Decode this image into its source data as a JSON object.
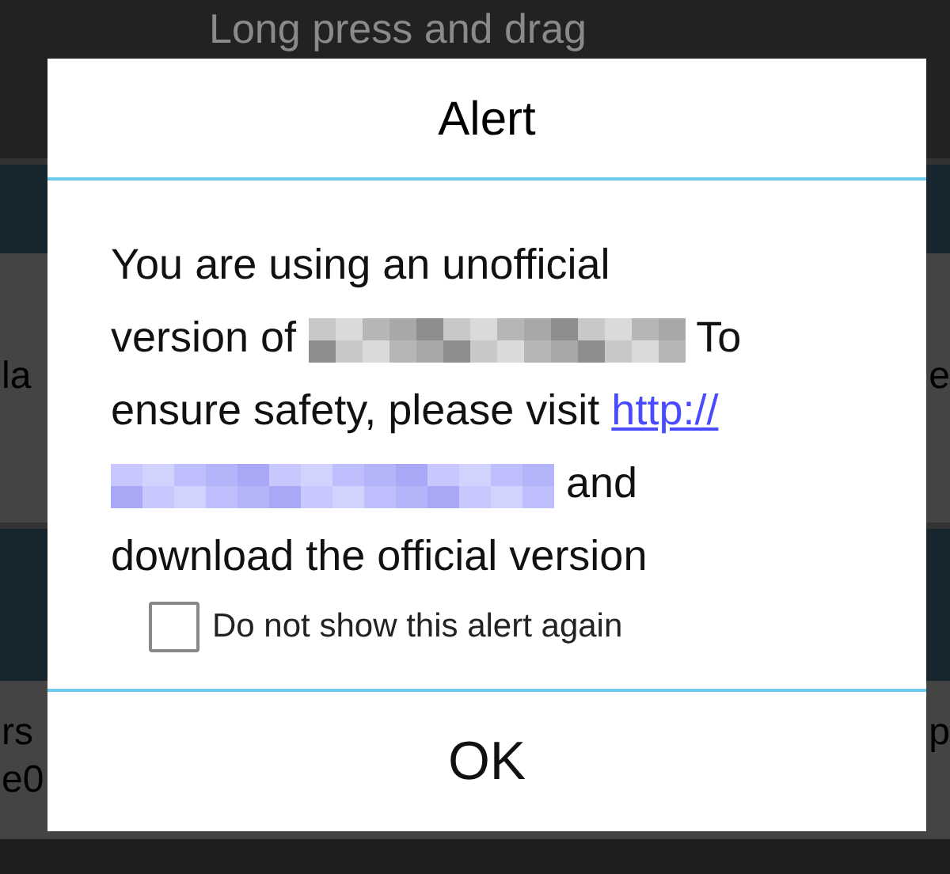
{
  "background": {
    "hint": "Long press and drag",
    "rows": [
      {
        "left": "la",
        "right": "e"
      },
      {
        "left": "rs",
        "left_2": "e0",
        "right": "p"
      }
    ]
  },
  "dialog": {
    "title": "Alert",
    "message": [
      [
        {
          "kind": "text",
          "text": "You are using an unofficial"
        }
      ],
      [
        {
          "kind": "text",
          "text": "version of"
        },
        {
          "kind": "redacted"
        },
        {
          "kind": "text",
          "text": "To"
        }
      ],
      [
        {
          "kind": "text",
          "text": "ensure safety, please visit"
        },
        {
          "kind": "link",
          "text": "http://"
        }
      ],
      [
        {
          "kind": "redacted_link"
        },
        {
          "kind": "text",
          "text": "and"
        }
      ],
      [
        {
          "kind": "text",
          "text": "download the official version"
        }
      ]
    ],
    "checkbox": {
      "label": "Do not show this alert again",
      "checked": false
    },
    "button": "OK"
  }
}
